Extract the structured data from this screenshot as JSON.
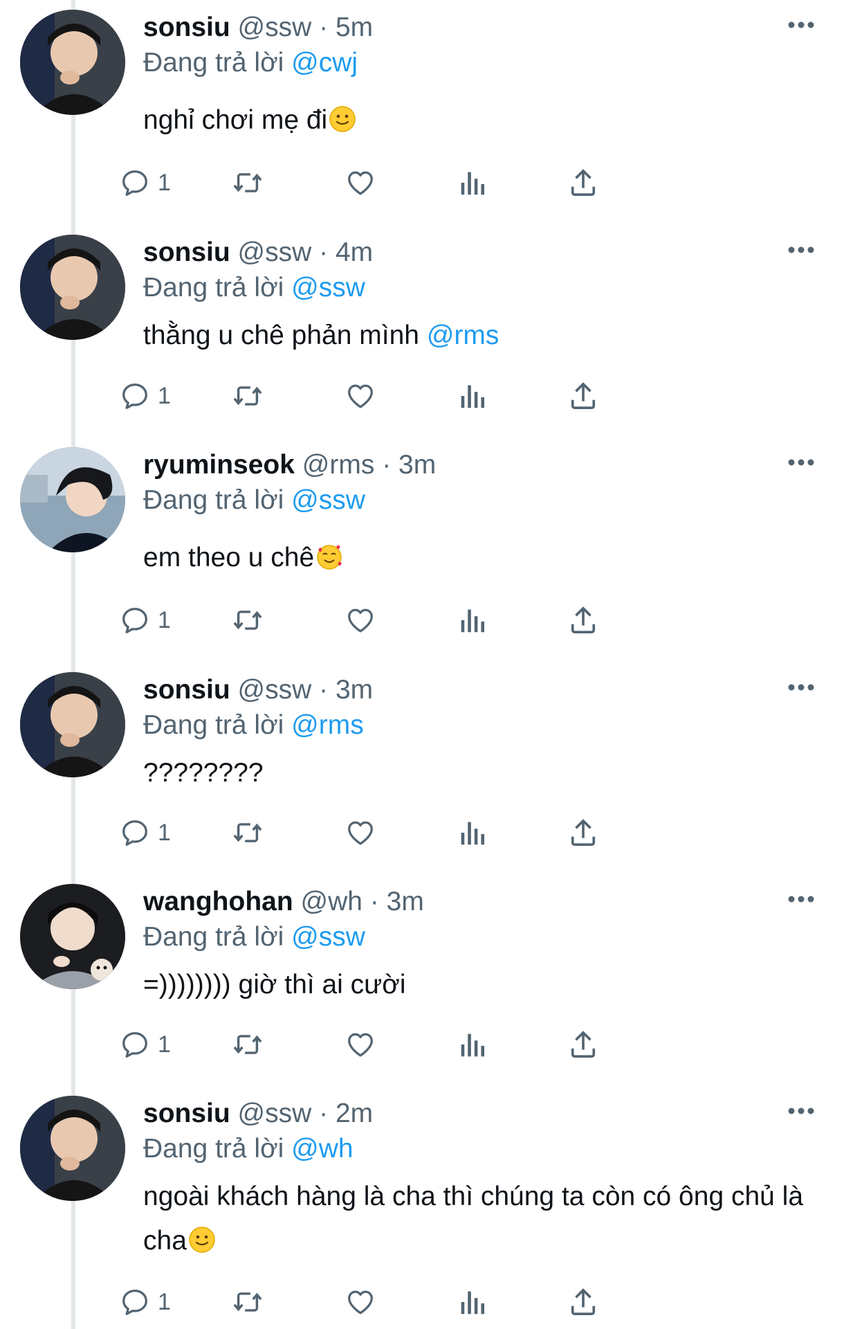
{
  "replying_prefix": "Đang trả lời",
  "tweets": [
    {
      "display_name": "sonsiu",
      "handle": "@ssw",
      "sep": "·",
      "time": "5m",
      "reply_to": "@cwj",
      "text": "nghỉ chơi mẹ đi",
      "text_emoji": "slightly-smiling-face",
      "reply_count": "1"
    },
    {
      "display_name": "sonsiu",
      "handle": "@ssw",
      "sep": "·",
      "time": "4m",
      "reply_to": "@ssw",
      "text": "thằng u chê phản mình ",
      "text_mention": "@rms",
      "reply_count": "1"
    },
    {
      "display_name": "ryuminseok",
      "handle": "@rms",
      "sep": "·",
      "time": "3m",
      "reply_to": "@ssw",
      "text": "em theo u chê",
      "text_emoji": "smiling-face-with-hearts",
      "reply_count": "1"
    },
    {
      "display_name": "sonsiu",
      "handle": "@ssw",
      "sep": "·",
      "time": "3m",
      "reply_to": "@rms",
      "text": "????????",
      "reply_count": "1"
    },
    {
      "display_name": "wanghohan",
      "handle": "@wh",
      "sep": "·",
      "time": "3m",
      "reply_to": "@ssw",
      "text": "=)))))))) giờ thì ai cười",
      "reply_count": "1"
    },
    {
      "display_name": "sonsiu",
      "handle": "@ssw",
      "sep": "·",
      "time": "2m",
      "reply_to": "@wh",
      "text": "ngoài khách hàng là cha thì chúng ta còn có ông chủ là cha",
      "text_emoji": "slightly-smiling-face",
      "reply_count": "1"
    }
  ],
  "icons": {
    "reply": "reply-bubble-icon",
    "retweet": "retweet-icon",
    "like": "heart-icon",
    "views": "views-chart-icon",
    "share": "share-upload-icon",
    "more": "more-dots-icon"
  },
  "colors": {
    "text": "#0f1419",
    "secondary": "#536471",
    "link": "#1d9bf0",
    "thread_line": "#e3e6e9"
  }
}
